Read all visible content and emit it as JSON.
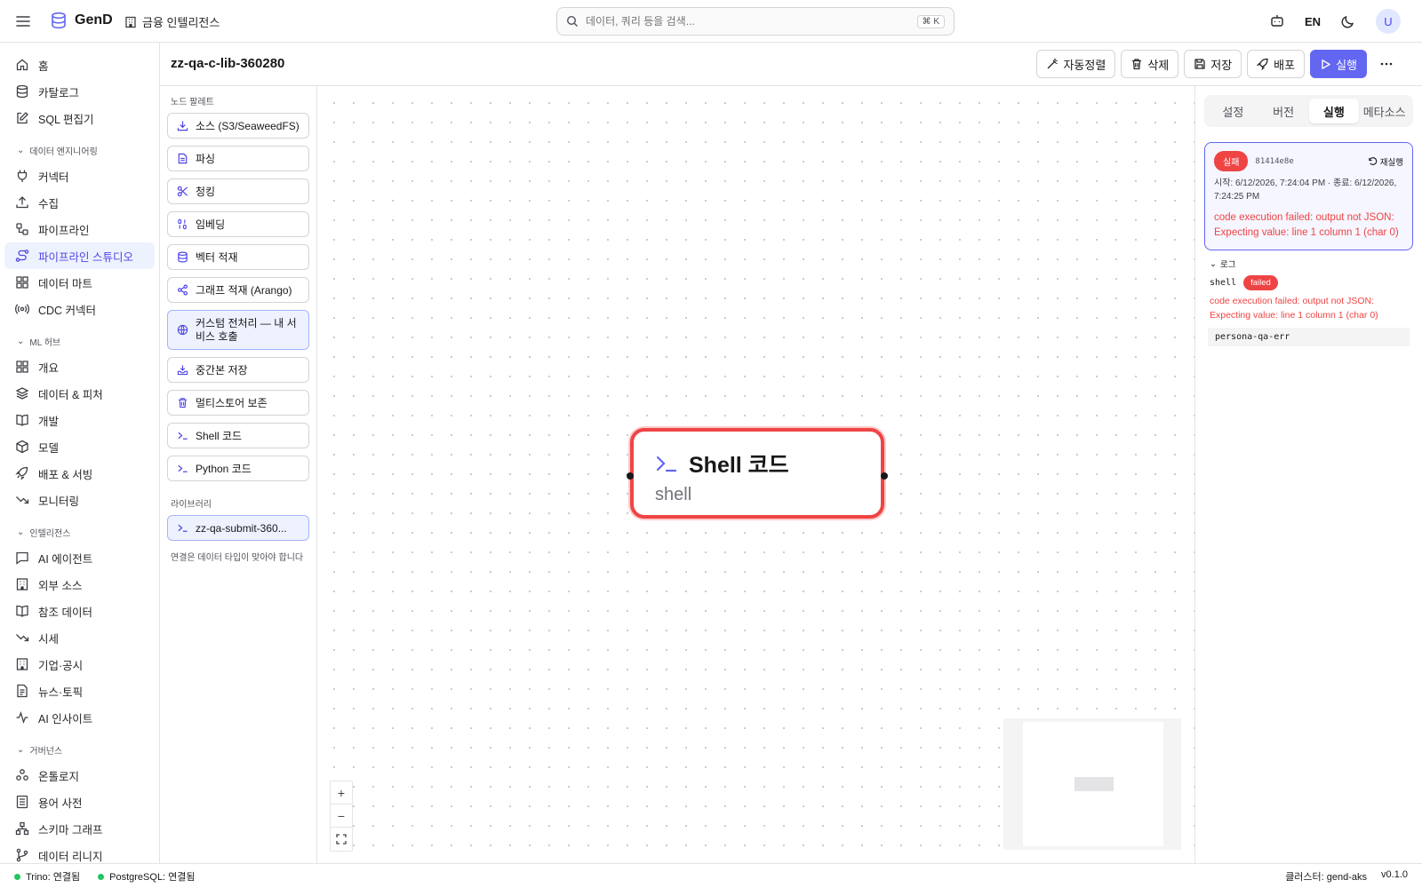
{
  "brand": {
    "name": "GenD",
    "workspace": "금융 인텔리전스"
  },
  "search": {
    "placeholder": "데이터, 쿼리 등을 검색...",
    "shortcut": "⌘ K"
  },
  "topbar": {
    "lang": "EN",
    "avatar": "U"
  },
  "sidebar": {
    "top": [
      "홈",
      "카탈로그",
      "SQL 편집기"
    ],
    "sections": [
      {
        "title": "데이터 엔지니어링",
        "items": [
          "커넥터",
          "수집",
          "파이프라인",
          "파이프라인 스튜디오",
          "데이터 마트",
          "CDC 커넥터"
        ]
      },
      {
        "title": "ML 허브",
        "items": [
          "개요",
          "데이터 & 피처",
          "개발",
          "모델",
          "배포 & 서빙",
          "모니터링"
        ]
      },
      {
        "title": "인텔리전스",
        "items": [
          "AI 에이전트",
          "외부 소스",
          "참조 데이터",
          "시세",
          "기업·공시",
          "뉴스·토픽",
          "AI 인사이트"
        ]
      },
      {
        "title": "거버넌스",
        "items": [
          "온톨로지",
          "용어 사전",
          "스키마 그래프",
          "데이터 리니지"
        ]
      }
    ]
  },
  "pipeline": {
    "title": "zz-qa-c-lib-360280"
  },
  "actions": {
    "autoalign": "자동정렬",
    "delete": "삭제",
    "save": "저장",
    "deploy": "배포",
    "run": "실행"
  },
  "palette": {
    "title": "노드 팔레트",
    "items": [
      "소스 (S3/SeaweedFS)",
      "파싱",
      "청킹",
      "임베딩",
      "벡터 적재",
      "그래프 적재 (Arango)",
      "커스텀 전처리 — 내 서비스 호출",
      "중간본 저장",
      "멀티스토어 보존",
      "Shell 코드",
      "Python 코드"
    ],
    "library_title": "라이브러리",
    "library_items": [
      "zz-qa-submit-360..."
    ],
    "note": "연결은 데이터 타입이 맞아야 합니다"
  },
  "node": {
    "title": "Shell 코드",
    "subtitle": "shell",
    "status_color": "#ef4444"
  },
  "panel": {
    "tabs": [
      "설정",
      "버전",
      "실행",
      "메타소스"
    ],
    "run": {
      "status": "실패",
      "id": "81414e8e",
      "rerun": "재실행",
      "time": "시작: 6/12/2026, 7:24:04 PM · 종료: 6/12/2026, 7:24:25 PM",
      "error": "code execution failed: output not JSON: Expecting value: line 1 column 1 (char 0)"
    },
    "log": {
      "title": "로그",
      "step": "shell",
      "status": "failed",
      "error": "code execution failed: output not JSON: Expecting value: line 1 column 1 (char 0)",
      "output": "persona-qa-err"
    }
  },
  "status": {
    "trino": "Trino: 연결됨",
    "postgres": "PostgreSQL: 연결됨",
    "cluster": "클러스터: gend-aks",
    "version": "v0.1.0"
  },
  "colors": {
    "accent": "#6366f1",
    "error": "#ef4444",
    "ok": "#22c55e"
  }
}
